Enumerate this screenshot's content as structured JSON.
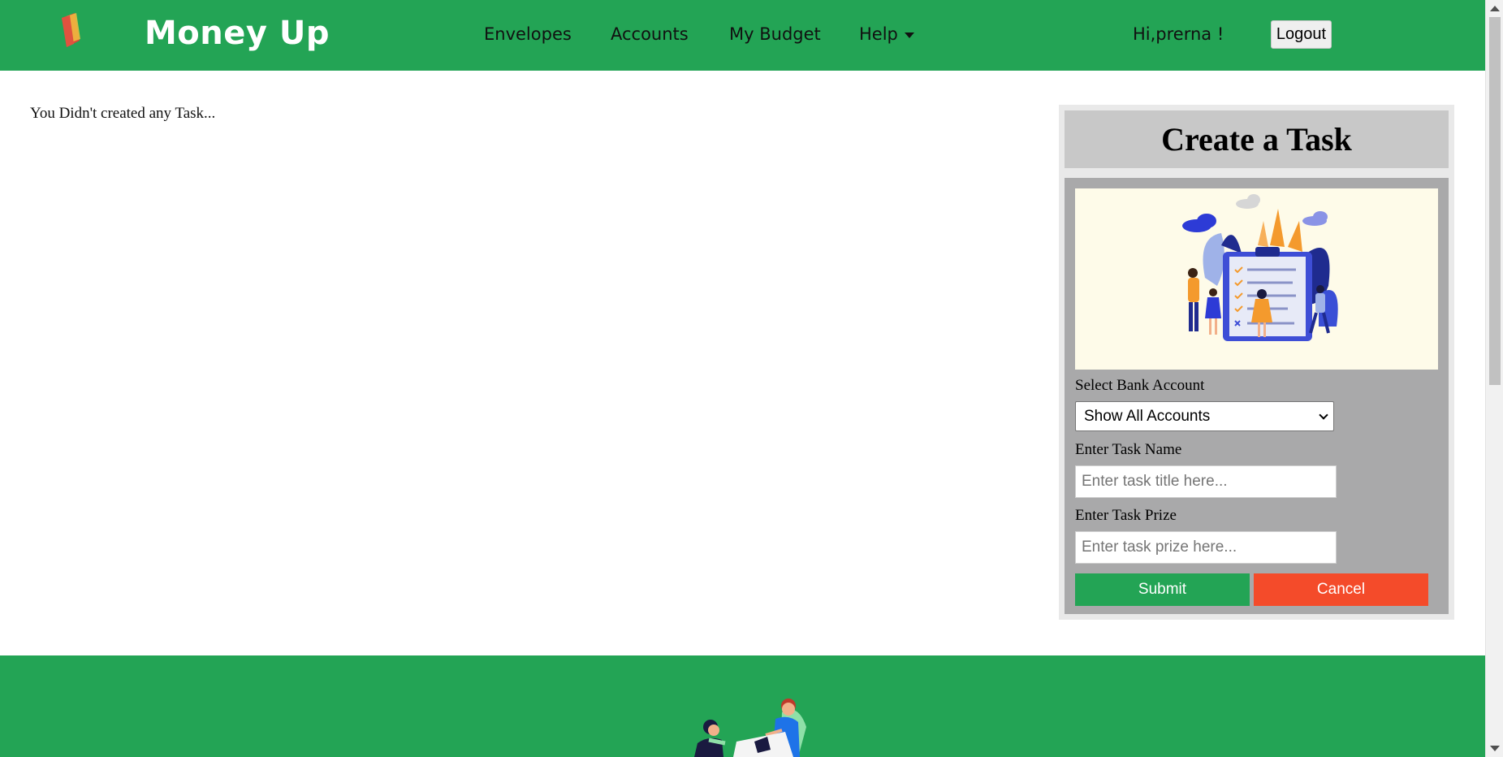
{
  "navbar": {
    "brand": "Money Up",
    "logo_icon": "wallet-logo-icon",
    "links": {
      "envelopes": "Envelopes",
      "accounts": "Accounts",
      "my_budget": "My Budget",
      "help": "Help"
    },
    "greeting": "Hi,prerna !",
    "logout_label": "Logout",
    "background_color": "#23a455"
  },
  "main": {
    "empty_message": "You Didn't created any Task..."
  },
  "task_form": {
    "title": "Create a Task",
    "illustration_icon": "task-checklist-illustration",
    "bank_label": "Select Bank Account",
    "bank_selected": "Show All Accounts",
    "name_label": "Enter Task Name",
    "name_placeholder": "Enter task title here...",
    "prize_label": "Enter Task Prize",
    "prize_placeholder": "Enter task prize here...",
    "submit_label": "Submit",
    "cancel_label": "Cancel",
    "submit_color": "#23a455",
    "cancel_color": "#f44b2a"
  },
  "footer": {
    "illustration_icon": "people-meeting-illustration"
  }
}
